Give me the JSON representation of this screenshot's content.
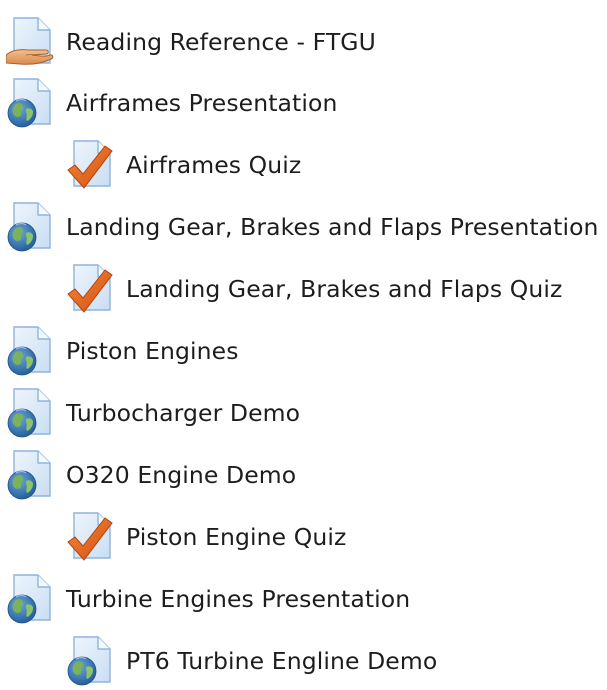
{
  "activities": [
    {
      "label": "Reading Reference - FTGU",
      "icon": "resource-page-hand-icon"
    },
    {
      "label": "Airframes Presentation",
      "icon": "url-globe-page-icon"
    },
    {
      "label": "Airframes Quiz",
      "icon": "quiz-checkmark-icon"
    },
    {
      "label": "Landing Gear, Brakes and Flaps Presentation",
      "icon": "url-globe-page-icon"
    },
    {
      "label": "Landing Gear, Brakes and Flaps Quiz",
      "icon": "quiz-checkmark-icon"
    },
    {
      "label": "Piston Engines",
      "icon": "url-globe-page-icon"
    },
    {
      "label": "Turbocharger Demo",
      "icon": "url-globe-page-icon"
    },
    {
      "label": "O320 Engine Demo",
      "icon": "url-globe-page-icon"
    },
    {
      "label": "Piston Engine Quiz",
      "icon": "quiz-checkmark-icon"
    },
    {
      "label": "Turbine Engines Presentation",
      "icon": "url-globe-page-icon"
    },
    {
      "label": "PT6 Turbine Engline Demo",
      "icon": "url-globe-page-icon"
    }
  ],
  "colors": {
    "page_fill": "#dbeaf8",
    "page_stroke": "#8fb4dc",
    "globe_ocean": "#2d6fae",
    "globe_land": "#7bb35a",
    "check": "#e8611f",
    "hand": "#e9a46a"
  }
}
